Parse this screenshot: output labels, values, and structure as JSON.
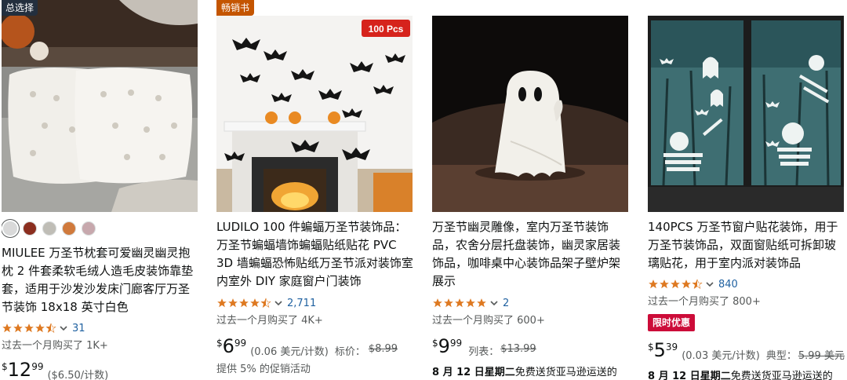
{
  "products": [
    {
      "badge": "总选择",
      "swatch_colors": [
        "#d9d9d9",
        "#8b2e1f",
        "#bfbdb6",
        "#d07a3c",
        "#c7a8ad"
      ],
      "title": "MIULEE 万圣节枕套可爱幽灵幽灵抱枕 2 件套柔软毛绒人造毛皮装饰靠垫套，适用于沙发沙发床门廊客厅万圣节装饰 18x18 英寸白色",
      "rating": 4.5,
      "rating_count": "31",
      "bought": "过去一个月购买了 1K+",
      "price_symbol": "$",
      "price_whole": "12",
      "price_fraction": "99",
      "unit_price": "($6.50/计数)"
    },
    {
      "badge": "畅销书",
      "image_text": "100 Pcs",
      "title": "LUDILO 100 件蝙蝠万圣节装饰品：万圣节蝙蝠墙饰蝙蝠贴纸贴花 PVC 3D 墙蝙蝠恐怖贴纸万圣节派对装饰室内室外 DIY 家庭窗户门装饰",
      "rating": 4.5,
      "rating_count": "2,711",
      "bought": "过去一个月购买了 4K+",
      "price_symbol": "$",
      "price_whole": "6",
      "price_fraction": "99",
      "unit_price": "(0.06 美元/计数)",
      "list_label": "标价：",
      "list_price": "$8.99",
      "promo": "提供 5% 的促销活动"
    },
    {
      "title": "万圣节幽灵雕像，室内万圣节装饰品，农舍分层托盘装饰，幽灵家居装饰品，咖啡桌中心装饰品架子壁炉架展示",
      "rating": 5,
      "rating_count": "2",
      "bought": "过去一个月购买了 600+",
      "price_symbol": "$",
      "price_whole": "9",
      "price_fraction": "99",
      "list_label": "列表：",
      "list_price": "$13.99",
      "delivery_date": "8 月 12 日星期二",
      "delivery_text": "免费送货亚马逊运送的"
    },
    {
      "title": "140PCS 万圣节窗户贴花装饰，用于万圣节装饰品，双面窗贴纸可拆卸玻璃贴花，用于室内派对装饰品",
      "rating": 4.5,
      "rating_count": "840",
      "bought": "过去一个月购买了 800+",
      "deal_badge": "限时优惠",
      "price_symbol": "$",
      "price_whole": "5",
      "price_fraction": "39",
      "unit_price": "(0.03 美元/计数)",
      "list_label": "典型：",
      "list_price": "5.99 美元",
      "delivery_date": "8 月 12 日星期二",
      "delivery_text": "免费送货亚马逊运送的"
    }
  ],
  "colors": {
    "star": "#de7921",
    "link": "#2162a1",
    "deal": "#cc0c39",
    "bestseller": "#c45500",
    "overall_pick": "#232f3e"
  }
}
